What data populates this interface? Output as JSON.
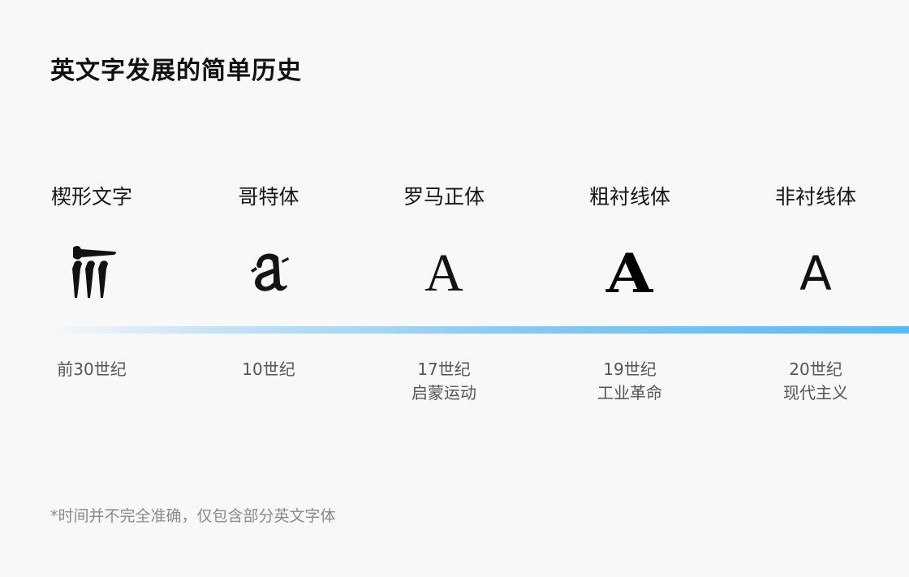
{
  "title": "英文字发展的简单历史",
  "timeline": [
    {
      "name": "楔形文字",
      "era": "前30世纪",
      "subtitle": ""
    },
    {
      "name": "哥特体",
      "era": "10世纪",
      "subtitle": ""
    },
    {
      "name": "罗马正体",
      "era": "17世纪",
      "subtitle": "启蒙运动",
      "glyph": "A"
    },
    {
      "name": "粗衬线体",
      "era": "19世纪",
      "subtitle": "工业革命",
      "glyph": "A"
    },
    {
      "name": "非衬线体",
      "era": "20世纪",
      "subtitle": "现代主义",
      "glyph": "A"
    }
  ],
  "footnote": "*时间并不完全准确，仅包含部分英文字体",
  "colors": {
    "background": "#f8f8f9",
    "timeline_accent": "#5bb8f3",
    "footnote": "#8a8a8a"
  },
  "icons": {
    "cuneiform": "cuneiform-glyph-icon",
    "gothic": "blackletter-a-icon"
  }
}
